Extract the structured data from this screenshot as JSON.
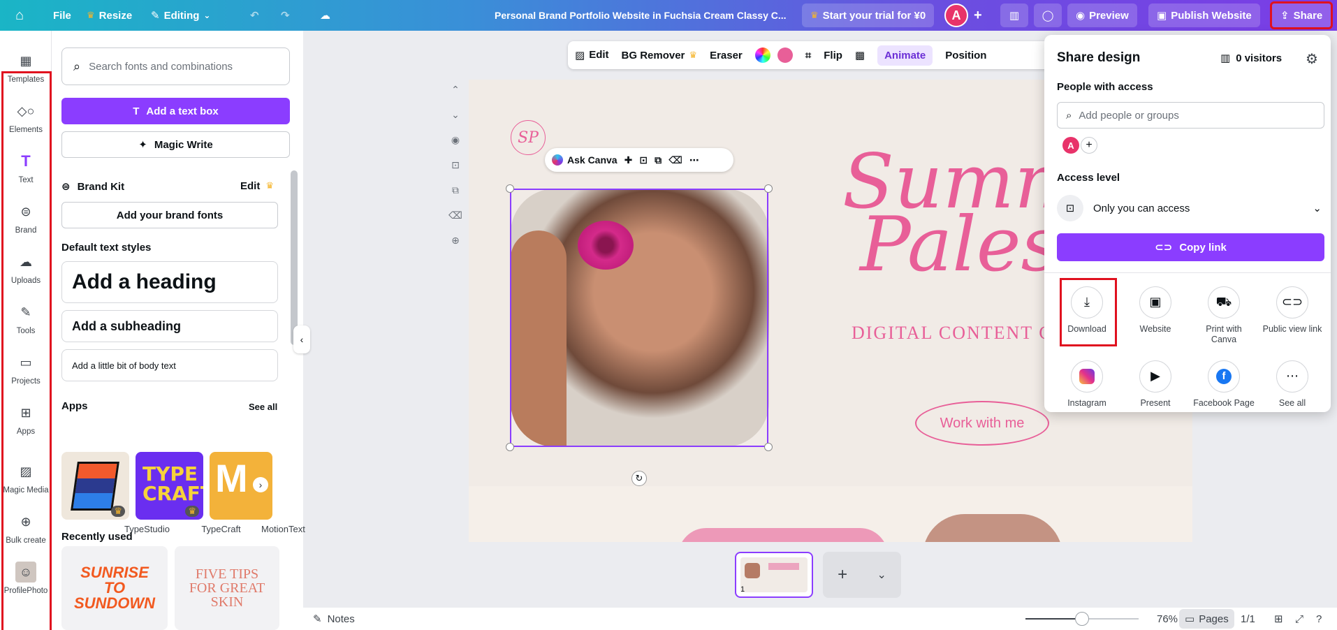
{
  "topbar": {
    "file": "File",
    "resize": "Resize",
    "editing": "Editing",
    "doc_title": "Personal Brand Portfolio Website in Fuchsia Cream Classy C...",
    "trial": "Start your trial for ¥0",
    "avatar_letter": "A",
    "preview": "Preview",
    "publish": "Publish Website",
    "share": "Share"
  },
  "rail": {
    "items": [
      {
        "label": "Templates",
        "icon": "templates-icon"
      },
      {
        "label": "Elements",
        "icon": "elements-icon"
      },
      {
        "label": "Text",
        "icon": "text-icon"
      },
      {
        "label": "Brand",
        "icon": "brand-icon"
      },
      {
        "label": "Uploads",
        "icon": "uploads-icon"
      },
      {
        "label": "Tools",
        "icon": "tools-icon"
      },
      {
        "label": "Projects",
        "icon": "projects-icon"
      },
      {
        "label": "Apps",
        "icon": "apps-icon"
      },
      {
        "label": "Magic Media",
        "icon": "magic-media-icon"
      },
      {
        "label": "Bulk create",
        "icon": "bulk-create-icon"
      },
      {
        "label": "ProfilePhoto",
        "icon": "profile-photo-icon"
      }
    ]
  },
  "panel": {
    "search_placeholder": "Search fonts and combinations",
    "add_text_box": "Add a text box",
    "magic_write": "Magic Write",
    "brand_kit": "Brand Kit",
    "brand_edit": "Edit",
    "add_brand_fonts": "Add your brand fonts",
    "default_styles": "Default text styles",
    "heading": "Add a heading",
    "subheading": "Add a subheading",
    "body": "Add a little bit of body text",
    "apps_title": "Apps",
    "see_all": "See all",
    "apps": [
      "TypeStudio",
      "TypeCraft",
      "MotionText"
    ],
    "recently_used": "Recently used",
    "recent_1": "SUNRISE TO SUNDOWN",
    "recent_2": "FIVE TIPS FOR GREAT SKIN"
  },
  "ctx_toolbar": {
    "edit": "Edit",
    "bg_remover": "BG Remover",
    "eraser": "Eraser",
    "flip": "Flip",
    "animate": "Animate",
    "position": "Position"
  },
  "canvas": {
    "monogram": "SP",
    "ask_canva": "Ask Canva",
    "title_line1": "Summ",
    "title_line2": "Paleso",
    "subtitle": "DIGITAL CONTENT CR",
    "work_button": "Work with me"
  },
  "bottom": {
    "page_number": "1",
    "notes": "Notes",
    "zoom": "76%",
    "zoom_level": 0.5,
    "pages": "Pages",
    "page_count": "1/1"
  },
  "share": {
    "title": "Share design",
    "visitors": "0 visitors",
    "people_label": "People with access",
    "add_placeholder": "Add people or groups",
    "avatar_letter": "A",
    "access_label": "Access level",
    "access_value": "Only you can access",
    "copy_link": "Copy link",
    "options": [
      {
        "label": "Download",
        "icon": "download-icon"
      },
      {
        "label": "Website",
        "icon": "website-icon"
      },
      {
        "label": "Print with Canva",
        "icon": "print-truck-icon"
      },
      {
        "label": "Public view link",
        "icon": "link-icon"
      },
      {
        "label": "Instagram",
        "icon": "instagram-icon"
      },
      {
        "label": "Present",
        "icon": "present-icon"
      },
      {
        "label": "Facebook Page",
        "icon": "facebook-icon"
      },
      {
        "label": "See all",
        "icon": "more-icon"
      }
    ]
  },
  "colors": {
    "accent": "#8b3dff",
    "pink": "#e85f98",
    "highlight": "#e0111f"
  }
}
